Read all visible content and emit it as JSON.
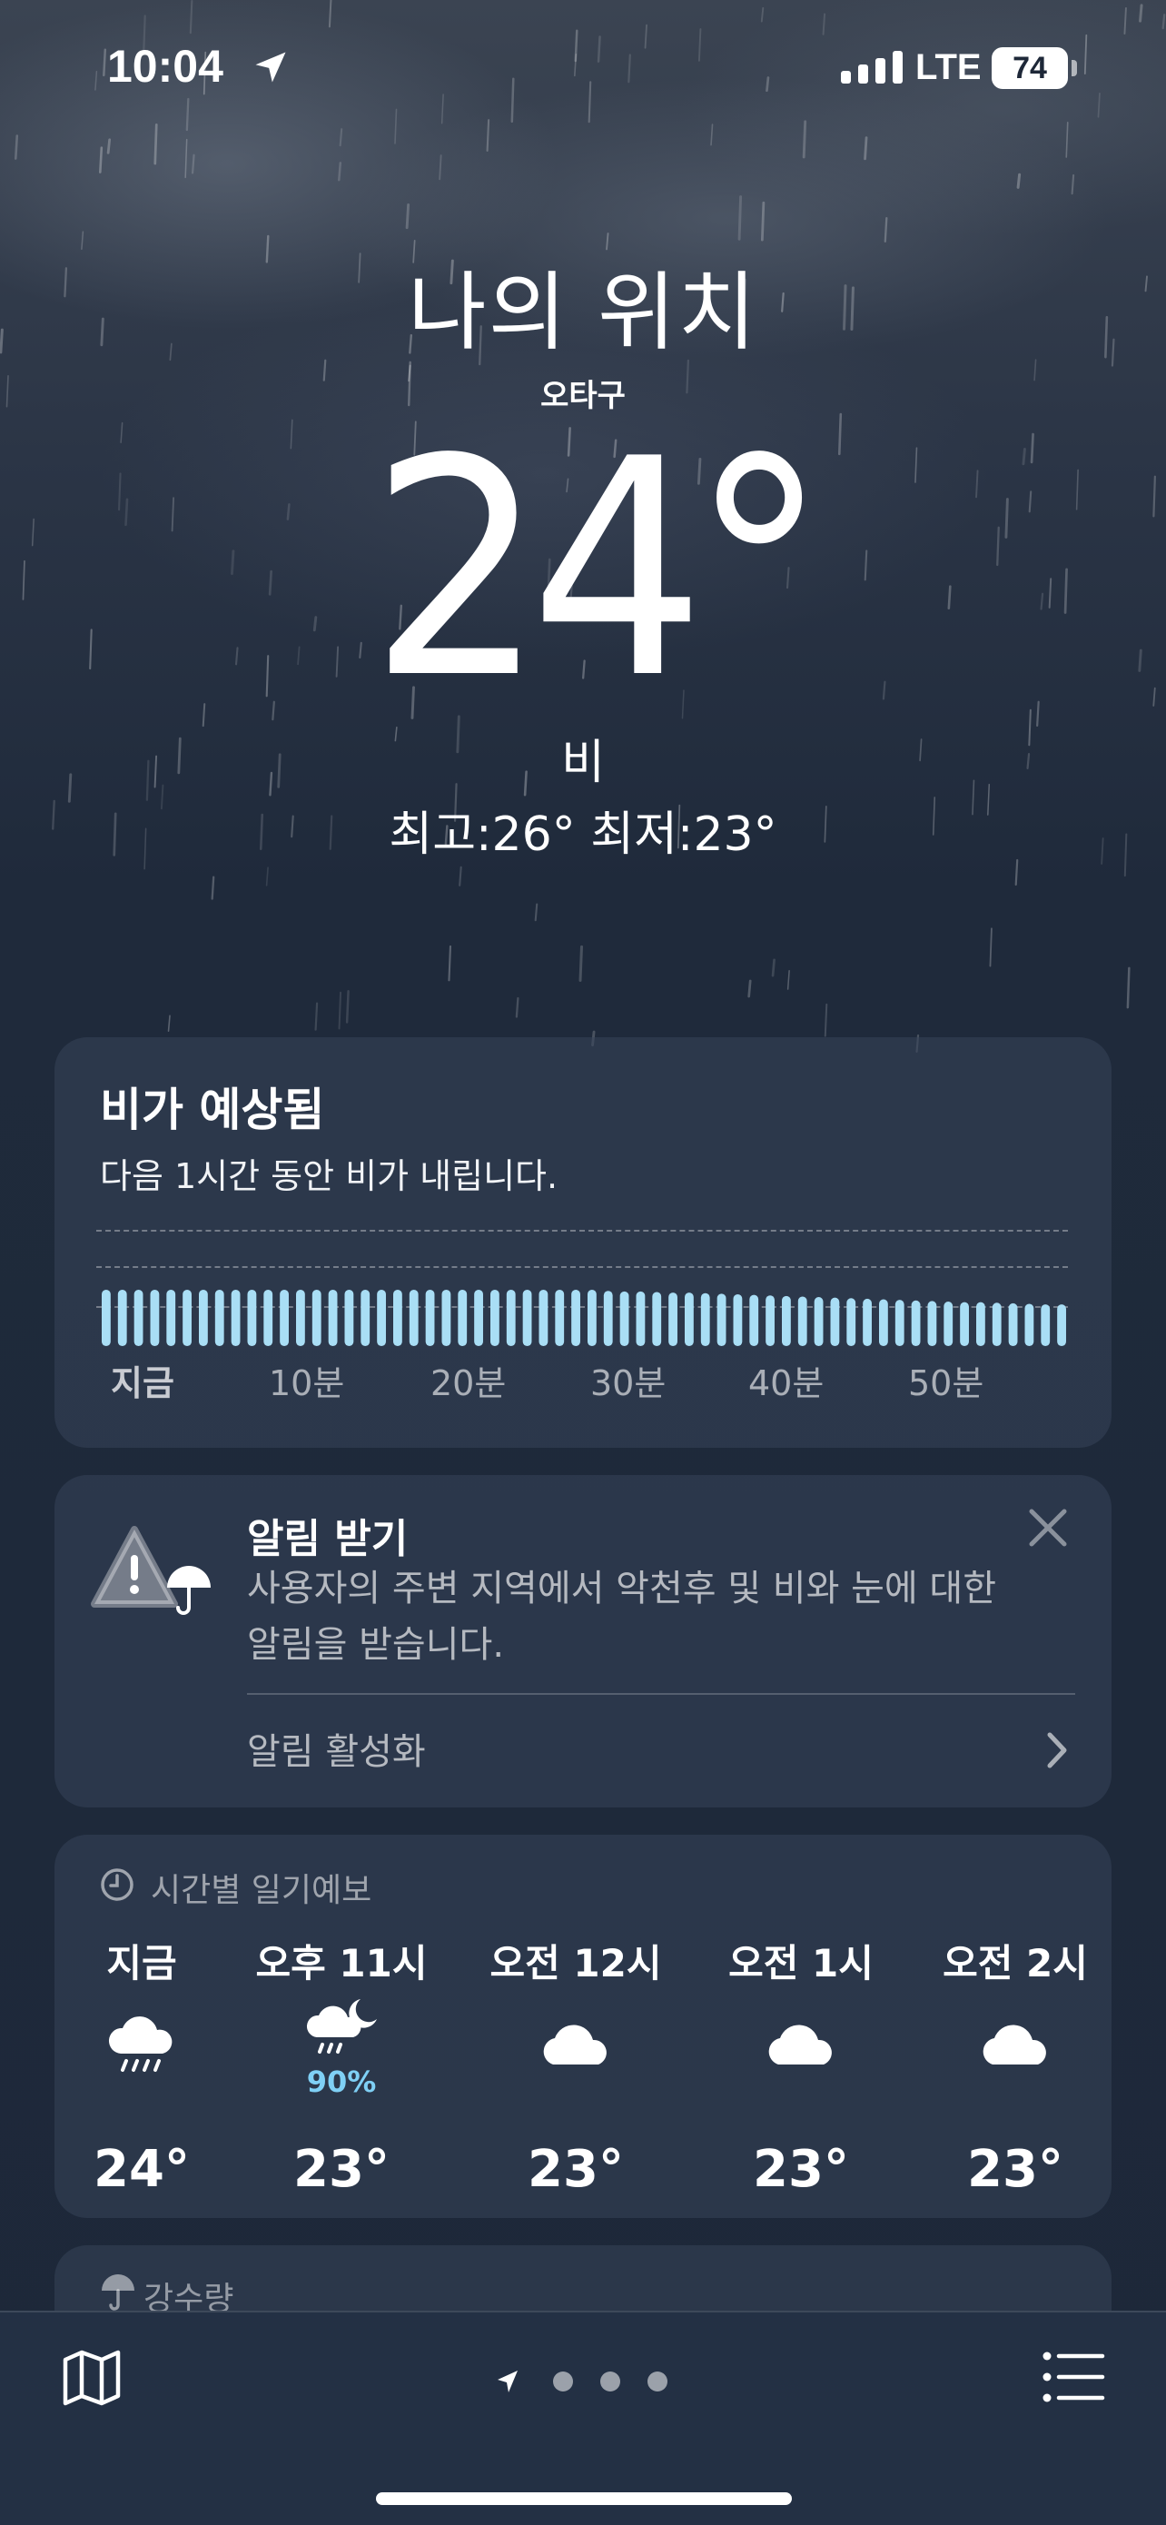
{
  "status": {
    "time": "10:04",
    "network": "LTE",
    "battery": "74"
  },
  "location": {
    "title": "나의 위치",
    "subtitle": "오타구"
  },
  "current": {
    "temp": "24°",
    "condition": "비",
    "hilo": "최고:26°  최저:23°"
  },
  "rain_card": {
    "title": "비가 예상됨",
    "description": "다음 1시간 동안 비가 내립니다.",
    "x_labels": [
      "지금",
      "10분",
      "20분",
      "30분",
      "40분",
      "50분"
    ]
  },
  "chart_data": {
    "type": "bar",
    "x_labels": [
      "지금",
      "10분",
      "20분",
      "30분",
      "40분",
      "50분"
    ],
    "values": [
      1.0,
      1.0,
      1.0,
      1.0,
      1.0,
      1.0,
      1.0,
      1.0,
      1.0,
      1.0,
      1.0,
      1.0,
      1.0,
      1.0,
      1.0,
      1.0,
      1.0,
      1.0,
      1.0,
      1.0,
      1.0,
      1.0,
      1.0,
      1.0,
      1.0,
      1.0,
      1.0,
      1.0,
      1.0,
      1.0,
      1.0,
      0.98,
      0.97,
      0.97,
      0.96,
      0.95,
      0.95,
      0.94,
      0.93,
      0.92,
      0.91,
      0.9,
      0.89,
      0.88,
      0.87,
      0.86,
      0.85,
      0.84,
      0.83,
      0.82,
      0.81,
      0.8,
      0.79,
      0.78,
      0.78,
      0.77,
      0.76,
      0.75,
      0.74,
      0.74
    ],
    "grid": true
  },
  "alert_card": {
    "title": "알림 받기",
    "description": "사용자의 주변 지역에서 악천후 및 비와 눈에 대한 알림을 받습니다.",
    "action": "알림 활성화"
  },
  "hourly": {
    "header": "시간별 일기예보",
    "items": [
      {
        "time": "지금",
        "icon": "rain-cloud-icon",
        "temp": "24°"
      },
      {
        "time": "오후 11시",
        "icon": "night-rain-icon",
        "precip": "90%",
        "temp": "23°"
      },
      {
        "time": "오전 12시",
        "icon": "cloud-icon",
        "temp": "23°"
      },
      {
        "time": "오전 1시",
        "icon": "cloud-icon",
        "temp": "23°"
      },
      {
        "time": "오전 2시",
        "icon": "cloud-icon",
        "temp": "23°"
      }
    ]
  },
  "precip_card": {
    "header": "강수량"
  },
  "colors": {
    "bar": "#a9def5",
    "precip_text": "#7fd0f5"
  }
}
